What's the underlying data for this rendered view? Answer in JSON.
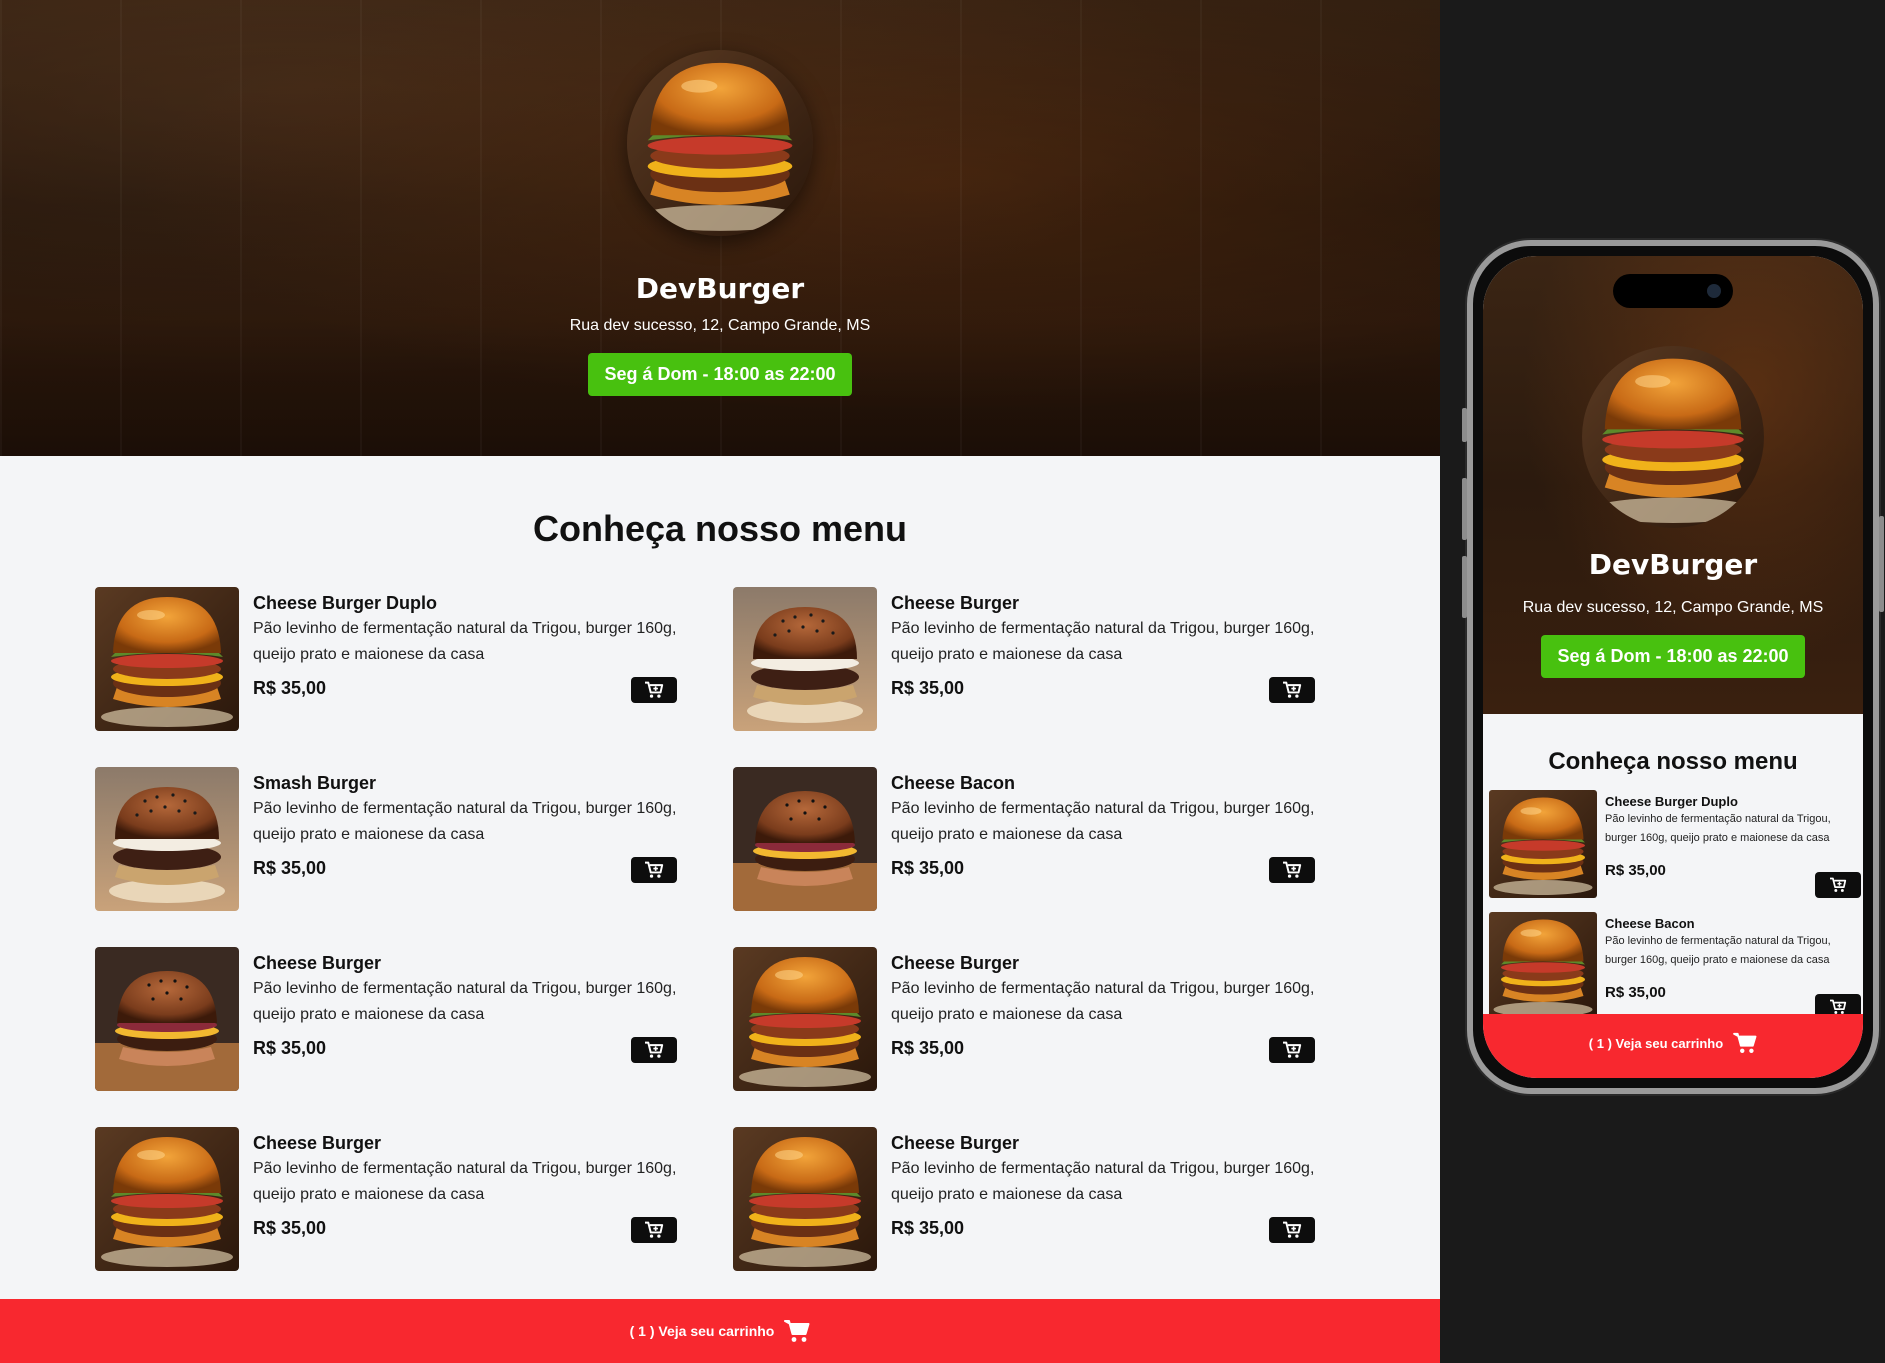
{
  "desktop": {
    "hero": {
      "brand_name": "DevBurger",
      "address": "Rua dev sucesso, 12, Campo Grande, MS",
      "hours": "Seg á Dom - 18:00 as 22:00"
    },
    "menu_title": "Conheça nosso menu",
    "items": [
      {
        "name": "Cheese Burger Duplo",
        "desc": "Pão levinho de fermentação natural da Trigou, burger 160g, queijo prato e maionese da casa",
        "price": "R$ 35,00"
      },
      {
        "name": "Cheese Burger",
        "desc": "Pão levinho de fermentação natural da Trigou, burger 160g, queijo prato e maionese da casa",
        "price": "R$ 35,00"
      },
      {
        "name": "Smash Burger",
        "desc": "Pão levinho de fermentação natural da Trigou, burger 160g, queijo prato e maionese da casa",
        "price": "R$ 35,00"
      },
      {
        "name": "Cheese Bacon",
        "desc": "Pão levinho de fermentação natural da Trigou, burger 160g, queijo prato e maionese da casa",
        "price": "R$ 35,00"
      },
      {
        "name": "Cheese Burger",
        "desc": "Pão levinho de fermentação natural da Trigou, burger 160g, queijo prato e maionese da casa",
        "price": "R$ 35,00"
      },
      {
        "name": "Cheese Burger",
        "desc": "Pão levinho de fermentação natural da Trigou, burger 160g, queijo prato e maionese da casa",
        "price": "R$ 35,00"
      },
      {
        "name": "Cheese Burger",
        "desc": "Pão levinho de fermentação natural da Trigou, burger 160g, queijo prato e maionese da casa",
        "price": "R$ 35,00"
      },
      {
        "name": "Cheese Burger",
        "desc": "Pão levinho de fermentação natural da Trigou, burger 160g, queijo prato e maionese da casa",
        "price": "R$ 35,00"
      }
    ],
    "cart_label": "( 1 ) Veja seu carrinho"
  },
  "mobile": {
    "hero": {
      "brand_name": "DevBurger",
      "address": "Rua dev sucesso, 12, Campo Grande, MS",
      "hours": "Seg á Dom - 18:00 as 22:00"
    },
    "menu_title": "Conheça nosso menu",
    "items": [
      {
        "name": "Cheese Burger Duplo",
        "desc": "Pão levinho de fermentação natural da Trigou, burger 160g, queijo prato e maionese da casa",
        "price": "R$ 35,00"
      },
      {
        "name": "Cheese Bacon",
        "desc": "Pão levinho de fermentação natural da Trigou, burger 160g, queijo prato e maionese da casa",
        "price": "R$ 35,00"
      }
    ],
    "cart_label": "( 1 ) Veja seu carrinho"
  },
  "colors": {
    "accent_green": "#48c10f",
    "cart_red": "#f8282f",
    "button_black": "#0d0d0d",
    "page_bg": "#f4f5f7"
  },
  "icons": {
    "add_to_cart": "cart-plus-icon",
    "cart": "shopping-cart-icon"
  }
}
